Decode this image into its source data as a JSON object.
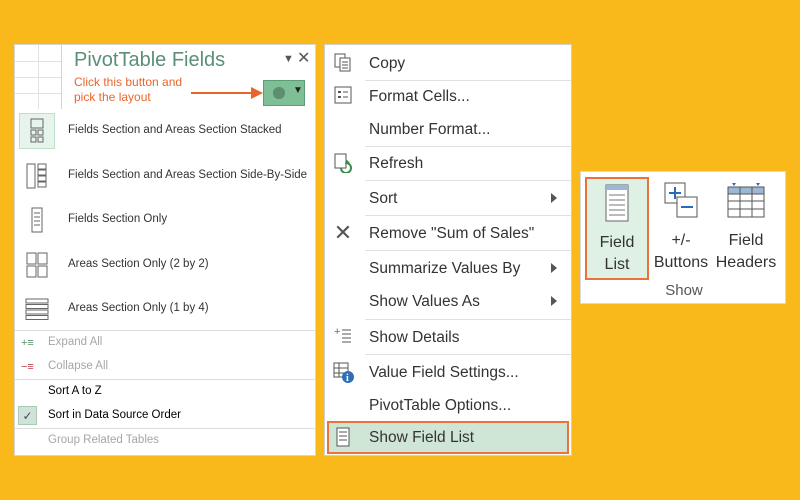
{
  "pivot_panel": {
    "title": "PivotTable Fields",
    "hint": "Click this button and pick the layout",
    "layouts": [
      {
        "label": "Fields Section and Areas Section Stacked",
        "icon": "layout-stacked-icon",
        "selected": true
      },
      {
        "label": "Fields Section and Areas Section Side-By-Side",
        "icon": "layout-side-by-side-icon",
        "selected": false
      },
      {
        "label": "Fields Section Only",
        "icon": "layout-fields-only-icon",
        "selected": false
      },
      {
        "label": "Areas Section Only (2 by 2)",
        "icon": "layout-areas-2x2-icon",
        "selected": false
      },
      {
        "label": "Areas Section Only (1 by 4)",
        "icon": "layout-areas-1x4-icon",
        "selected": false
      }
    ],
    "options": [
      {
        "label": "Expand All",
        "enabled": false
      },
      {
        "label": "Collapse All",
        "enabled": false
      },
      {
        "label": "Sort A to Z",
        "enabled": true
      },
      {
        "label": "Sort in Data Source Order",
        "enabled": true,
        "checked": true
      },
      {
        "label": "Group Related Tables",
        "enabled": false
      }
    ]
  },
  "context_menu": {
    "items": [
      {
        "label": "Copy",
        "icon": "copy-icon"
      },
      {
        "label": "Format Cells...",
        "icon": "format-cells-icon"
      },
      {
        "label": "Number Format...",
        "icon": ""
      },
      {
        "label": "Refresh",
        "icon": "refresh-icon"
      },
      {
        "label": "Sort",
        "icon": "",
        "submenu": true
      },
      {
        "label": "Remove \"Sum of  Sales\"",
        "icon": "remove-x-icon"
      },
      {
        "label": "Summarize Values By",
        "icon": "",
        "submenu": true
      },
      {
        "label": "Show Values As",
        "icon": "",
        "submenu": true
      },
      {
        "label": "Show Details",
        "icon": "show-details-icon"
      },
      {
        "label": "Value Field Settings...",
        "icon": "value-field-settings-icon"
      },
      {
        "label": "PivotTable Options...",
        "icon": ""
      },
      {
        "label": "Show Field List",
        "icon": "field-list-icon",
        "highlighted": true
      }
    ]
  },
  "ribbon": {
    "buttons": [
      {
        "line1": "Field",
        "line2": "List",
        "icon": "field-list-icon",
        "selected": true
      },
      {
        "line1": "+/-",
        "line2": "Buttons",
        "icon": "plus-minus-buttons-icon",
        "selected": false
      },
      {
        "line1": "Field",
        "line2": "Headers",
        "icon": "field-headers-icon",
        "selected": false
      }
    ],
    "group_label": "Show"
  },
  "colors": {
    "background": "#f9b91a",
    "accent_orange": "#e8743a",
    "highlight_green": "#cfe6d6",
    "title_green": "#5b8f78"
  }
}
